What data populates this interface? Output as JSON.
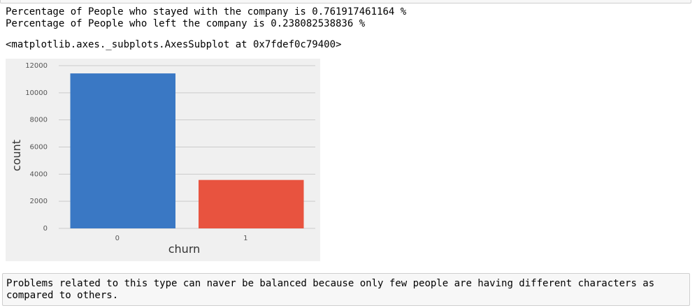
{
  "output": {
    "line1": "Percentage of People who stayed with the company is 0.761917461164 %",
    "line2": "Percentage of People who left the company is 0.238082538836 %",
    "line3": "<matplotlib.axes._subplots.AxesSubplot at 0x7fdef0c79400>"
  },
  "chart_data": {
    "type": "bar",
    "categories": [
      "0",
      "1"
    ],
    "values": [
      11428,
      3571
    ],
    "colors": [
      "#3a78c4",
      "#e8533f"
    ],
    "xlabel": "churn",
    "ylabel": "count",
    "ylim": [
      0,
      12000
    ],
    "yticks": [
      "0",
      "2000",
      "4000",
      "6000",
      "8000",
      "10000",
      "12000"
    ],
    "grid": true,
    "background": "#f0f0f0"
  },
  "markdown": {
    "text": "Problems related to this type can naver be balanced because only few people are having different characters as compared to others."
  }
}
